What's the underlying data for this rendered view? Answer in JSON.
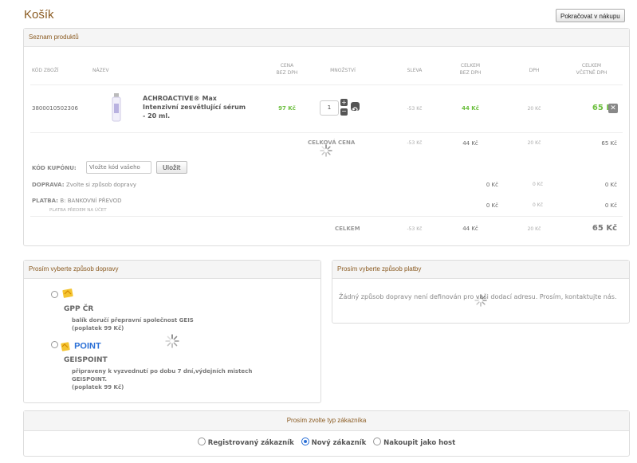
{
  "page": {
    "title": "Košík",
    "continue_label": "Pokračovat v nákupu"
  },
  "products": {
    "header": "Seznam produktů",
    "columns": {
      "code": "KÓD ZBOŽÍ",
      "name": "NÁZEV",
      "price_1": "CENA",
      "price_2": "BEZ DPH",
      "qty": "MNOŽSTVÍ",
      "discount": "SLEVA",
      "total_1": "CELKEM",
      "total_2": "BEZ DPH",
      "vat": "DPH",
      "total_vat_1": "CELKEM",
      "total_vat_2": "VČETNĚ DPH"
    },
    "item": {
      "code": "3800010502306",
      "name": "ACHROACTIVE® Max Intenzivní zesvětlující sérum - 20 ml.",
      "price": "97 Kč",
      "qty": "1",
      "discount": "-53 Kč",
      "total": "44 Kč",
      "vat": "20 Kč",
      "total_vat": "65 Kč"
    },
    "subtotal": {
      "label": "CELKOVÁ CENA",
      "discount": "-53 Kč",
      "total": "44 Kč",
      "vat": "20 Kč",
      "total_vat": "65 Kč"
    },
    "coupon": {
      "label": "KÓD KUPÓNU:",
      "placeholder": "Vložte kód vašeho",
      "button": "Uložit"
    },
    "shipping": {
      "label": "DOPRAVA:",
      "value": "Zvolte si způsob dopravy",
      "total": "0 Kč",
      "vat": "0 Kč",
      "total_vat": "0 Kč"
    },
    "payment": {
      "label": "PLATBA:",
      "value": "B: BANKOVNÍ PŘEVOD",
      "sub": "PLATBA PŘEDEM NA ÚČET",
      "total": "0 Kč",
      "vat": "0 Kč",
      "total_vat": "0 Kč"
    },
    "grand": {
      "label": "CELKEM",
      "discount": "-53 Kč",
      "total": "44 Kč",
      "vat": "20 Kč",
      "total_vat": "65 Kč"
    }
  },
  "shipping_panel": {
    "header": "Prosím vyberte způsob dopravy",
    "options": [
      {
        "name": "GPP ČR",
        "desc1": "balík doručí přepravní společnost GEIS",
        "desc2": "(poplatek 99 Kč)"
      },
      {
        "name": "GEISPOINT",
        "logo_text": "POINT",
        "desc1": "připraveny k vyzvednutí po dobu 7 dní,výdejních mistech",
        "desc2": "GEISPOINT.",
        "desc3": "(poplatek 99 Kč)"
      }
    ]
  },
  "payment_panel": {
    "header": "Prosím vyberte způsob platby",
    "message": "Žádný způsob dopravy není definován pro vaši dodací adresu. Prosím, kontaktujte nás."
  },
  "customer_panel": {
    "header": "Prosím zvolte typ zákazníka",
    "options": [
      "Registrovaný zákazník",
      "Nový zákazník",
      "Nakoupit jako host"
    ],
    "selected": "Nový zákazník"
  },
  "colors": {
    "accent": "#8a5a20",
    "price_green": "#6cbf3e",
    "radio_blue": "#2a6fd6"
  }
}
